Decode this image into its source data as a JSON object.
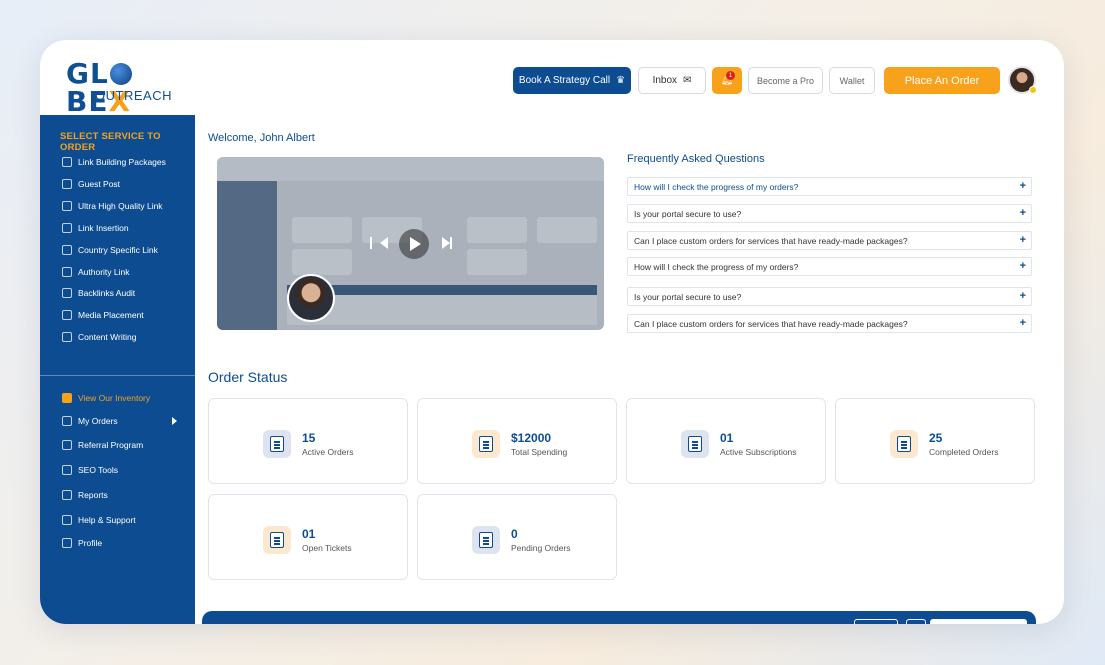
{
  "header": {
    "logo_main": "GLOBEX",
    "logo_sub": "OUTREACH",
    "book_call": "Book A Strategy Call",
    "inbox": "Inbox",
    "notification_count": "1",
    "become_pro": "Become a Pro",
    "wallet": "Wallet",
    "place_order": "Place An Order"
  },
  "sidebar": {
    "title": "SELECT SERVICE TO ORDER",
    "services": [
      {
        "label": "Link Building Packages"
      },
      {
        "label": "Guest Post"
      },
      {
        "label": "Ultra High Quality Link"
      },
      {
        "label": "Link Insertion"
      },
      {
        "label": "Country Specific Link"
      },
      {
        "label": "Authority Link"
      },
      {
        "label": "Backlinks Audit"
      },
      {
        "label": "Media Placement"
      },
      {
        "label": "Content Writing"
      }
    ],
    "nav": [
      {
        "label": "View Our Inventory"
      },
      {
        "label": "My Orders"
      },
      {
        "label": "Referral Program"
      },
      {
        "label": "SEO Tools"
      },
      {
        "label": "Reports"
      },
      {
        "label": "Help & Support"
      },
      {
        "label": "Profile"
      }
    ]
  },
  "main": {
    "welcome": "Welcome, John Albert",
    "faq_title": "Frequently Asked Questions",
    "faqs": [
      {
        "q": "How will I check the progress of my orders?"
      },
      {
        "q": "Is your portal secure to use?"
      },
      {
        "q": "Can I place custom orders for services that have ready-made packages?"
      },
      {
        "q": "How will I check the progress of my orders?"
      },
      {
        "q": "Is your portal secure to use?"
      },
      {
        "q": "Can I place custom orders for services that have ready-made packages?"
      }
    ],
    "order_status_title": "Order Status",
    "stats": [
      {
        "value": "15",
        "label": "Active Orders"
      },
      {
        "value": "$12000",
        "label": "Total Spending"
      },
      {
        "value": "01",
        "label": "Active Subscriptions"
      },
      {
        "value": "25",
        "label": "Completed Orders"
      },
      {
        "value": "01",
        "label": "Open Tickets"
      },
      {
        "value": "0",
        "label": "Pending Orders"
      }
    ]
  },
  "colors": {
    "brand_blue": "#0d4c91",
    "accent_orange": "#f7a21a"
  }
}
